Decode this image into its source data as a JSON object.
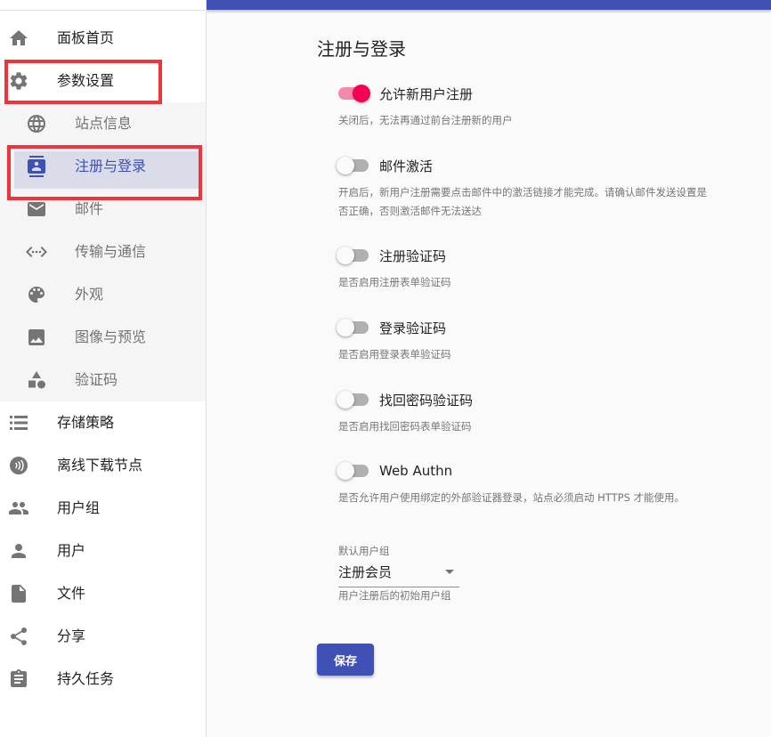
{
  "colors": {
    "primary": "#3f51b5",
    "accent": "#f50057",
    "highlight": "#f2333b"
  },
  "sidebar": {
    "items": [
      {
        "label": "面板首页",
        "icon": "home-icon"
      },
      {
        "label": "参数设置",
        "icon": "gear-icon"
      },
      {
        "label": "存储策略",
        "icon": "storage-list-icon"
      },
      {
        "label": "离线下载节点",
        "icon": "download-node-icon"
      },
      {
        "label": "用户组",
        "icon": "group-icon"
      },
      {
        "label": "用户",
        "icon": "person-icon"
      },
      {
        "label": "文件",
        "icon": "file-icon"
      },
      {
        "label": "分享",
        "icon": "share-icon"
      },
      {
        "label": "持久任务",
        "icon": "task-icon"
      }
    ],
    "sub_items": [
      {
        "label": "站点信息",
        "icon": "globe-icon"
      },
      {
        "label": "注册与登录",
        "icon": "contact-icon",
        "selected": true
      },
      {
        "label": "邮件",
        "icon": "mail-icon"
      },
      {
        "label": "传输与通信",
        "icon": "code-icon"
      },
      {
        "label": "外观",
        "icon": "palette-icon"
      },
      {
        "label": "图像与预览",
        "icon": "image-icon"
      },
      {
        "label": "验证码",
        "icon": "shapes-icon"
      }
    ]
  },
  "main": {
    "title": "注册与登录",
    "settings": [
      {
        "label": "允许新用户注册",
        "on": true,
        "helper": "关闭后，无法再通过前台注册新的用户"
      },
      {
        "label": "邮件激活",
        "on": false,
        "helper": "开启后，新用户注册需要点击邮件中的激活链接才能完成。请确认邮件发送设置是否正确，否则激活邮件无法送达"
      },
      {
        "label": "注册验证码",
        "on": false,
        "helper": "是否启用注册表单验证码"
      },
      {
        "label": "登录验证码",
        "on": false,
        "helper": "是否启用登录表单验证码"
      },
      {
        "label": "找回密码验证码",
        "on": false,
        "helper": "是否启用找回密码表单验证码"
      },
      {
        "label": "Web Authn",
        "on": false,
        "helper": "是否允许用户使用绑定的外部验证器登录，站点必须启动 HTTPS 才能使用。"
      }
    ],
    "default_group": {
      "label": "默认用户组",
      "value": "注册会员",
      "helper": "用户注册后的初始用户组"
    },
    "save_label": "保存"
  }
}
